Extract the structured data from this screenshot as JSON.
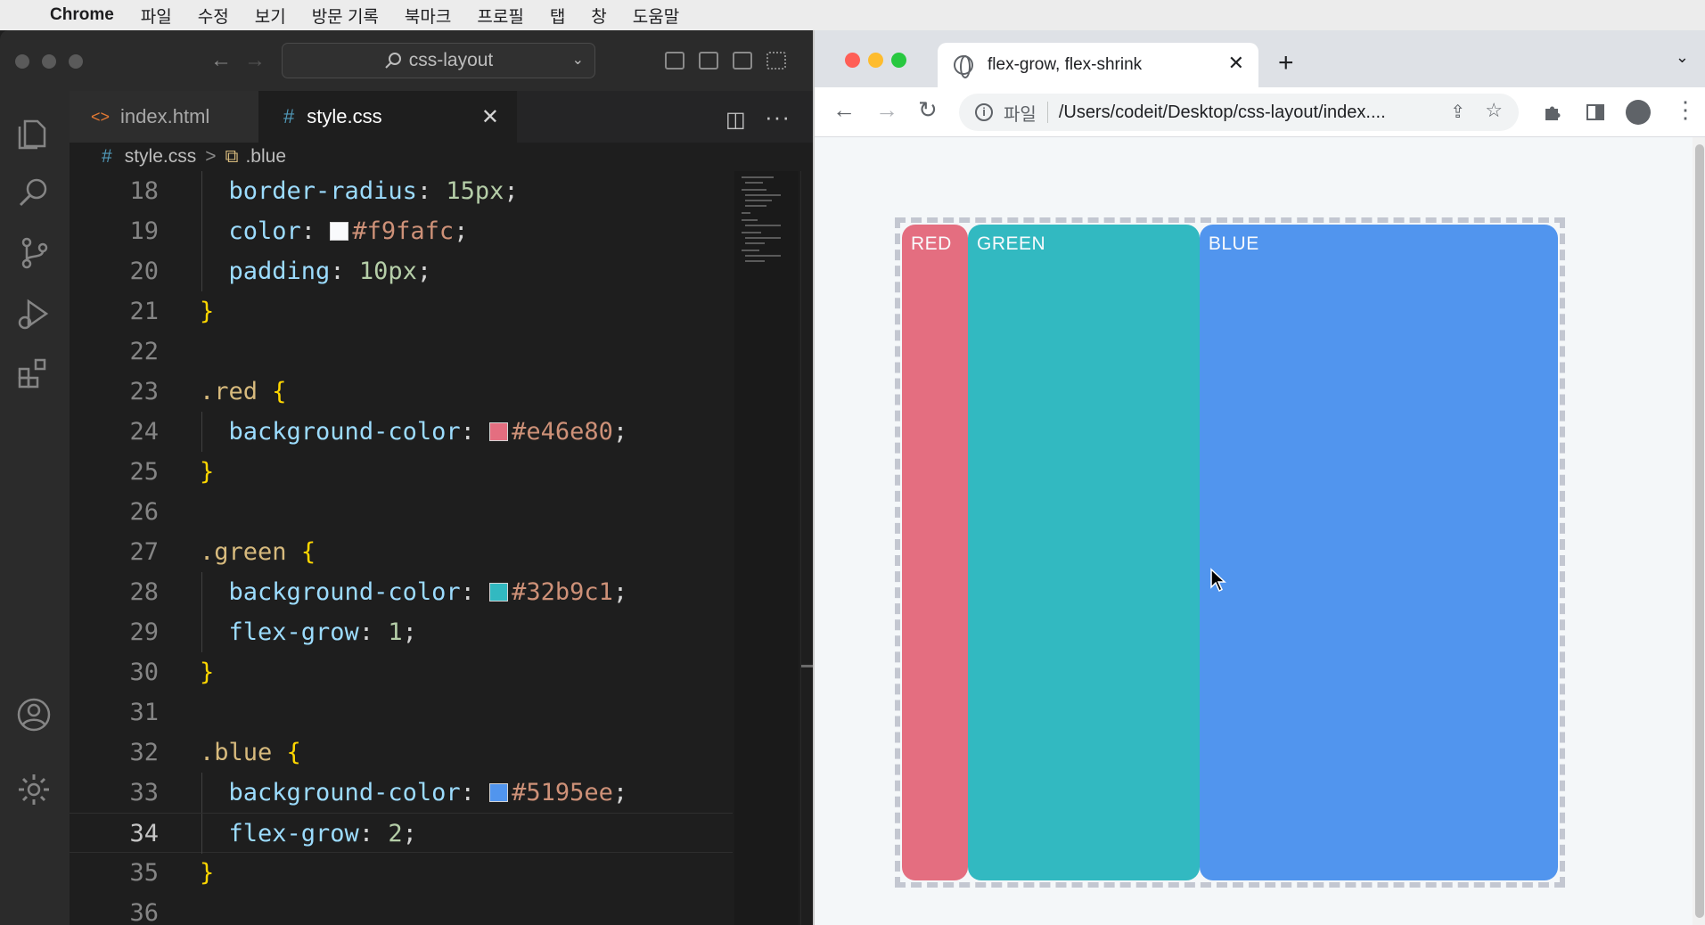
{
  "menubar": {
    "app_name": "Chrome",
    "items": [
      "파일",
      "수정",
      "보기",
      "방문 기록",
      "북마크",
      "프로필",
      "탭",
      "창",
      "도움말"
    ]
  },
  "vscode": {
    "search": {
      "text": "css-layout"
    },
    "tabs": [
      {
        "label": "index.html",
        "icon": "html-code-icon"
      },
      {
        "label": "style.css",
        "icon": "hash-icon",
        "active": true
      }
    ],
    "breadcrumb": {
      "file": "style.css",
      "separator": ">",
      "symbol": ".blue"
    },
    "code_lines": [
      {
        "n": "18",
        "tokens": [
          [
            "prop",
            "border-radius"
          ],
          [
            "punc",
            ": "
          ],
          [
            "num",
            "15px"
          ],
          [
            "punc",
            ";"
          ]
        ],
        "indent": true
      },
      {
        "n": "19",
        "tokens": [
          [
            "prop",
            "color"
          ],
          [
            "punc",
            ": "
          ],
          [
            "swatch",
            "#f9fafc"
          ],
          [
            "str",
            "#f9fafc"
          ],
          [
            "punc",
            ";"
          ]
        ],
        "indent": true
      },
      {
        "n": "20",
        "tokens": [
          [
            "prop",
            "padding"
          ],
          [
            "punc",
            ": "
          ],
          [
            "num",
            "10px"
          ],
          [
            "punc",
            ";"
          ]
        ],
        "indent": true
      },
      {
        "n": "21",
        "tokens": [
          [
            "brace",
            "}"
          ]
        ]
      },
      {
        "n": "22",
        "tokens": []
      },
      {
        "n": "23",
        "tokens": [
          [
            "sel",
            ".red"
          ],
          [
            "punc",
            " "
          ],
          [
            "brace",
            "{"
          ]
        ]
      },
      {
        "n": "24",
        "tokens": [
          [
            "prop",
            "background-color"
          ],
          [
            "punc",
            ": "
          ],
          [
            "swatch",
            "#e46e80"
          ],
          [
            "str",
            "#e46e80"
          ],
          [
            "punc",
            ";"
          ]
        ],
        "indent": true
      },
      {
        "n": "25",
        "tokens": [
          [
            "brace",
            "}"
          ]
        ]
      },
      {
        "n": "26",
        "tokens": []
      },
      {
        "n": "27",
        "tokens": [
          [
            "sel",
            ".green"
          ],
          [
            "punc",
            " "
          ],
          [
            "brace",
            "{"
          ]
        ]
      },
      {
        "n": "28",
        "tokens": [
          [
            "prop",
            "background-color"
          ],
          [
            "punc",
            ": "
          ],
          [
            "swatch",
            "#32b9c1"
          ],
          [
            "str",
            "#32b9c1"
          ],
          [
            "punc",
            ";"
          ]
        ],
        "indent": true
      },
      {
        "n": "29",
        "tokens": [
          [
            "prop",
            "flex-grow"
          ],
          [
            "punc",
            ": "
          ],
          [
            "num",
            "1"
          ],
          [
            "punc",
            ";"
          ]
        ],
        "indent": true
      },
      {
        "n": "30",
        "tokens": [
          [
            "brace",
            "}"
          ]
        ]
      },
      {
        "n": "31",
        "tokens": []
      },
      {
        "n": "32",
        "tokens": [
          [
            "sel",
            ".blue"
          ],
          [
            "punc",
            " "
          ],
          [
            "brace",
            "{"
          ]
        ]
      },
      {
        "n": "33",
        "tokens": [
          [
            "prop",
            "background-color"
          ],
          [
            "punc",
            ": "
          ],
          [
            "swatch",
            "#5195ee"
          ],
          [
            "str",
            "#5195ee"
          ],
          [
            "punc",
            ";"
          ]
        ],
        "indent": true
      },
      {
        "n": "34",
        "tokens": [
          [
            "prop",
            "flex-grow"
          ],
          [
            "punc",
            ": "
          ],
          [
            "num",
            "2"
          ],
          [
            "punc",
            ";"
          ]
        ],
        "indent": true,
        "active": true
      },
      {
        "n": "35",
        "tokens": [
          [
            "brace",
            "}"
          ]
        ]
      },
      {
        "n": "36",
        "tokens": []
      }
    ]
  },
  "chrome": {
    "tab_title": "flex-grow, flex-shrink",
    "address": {
      "scheme_label": "파일",
      "url": "/Users/codeit/Desktop/css-layout/index...."
    },
    "page": {
      "boxes": [
        {
          "label": "RED",
          "color": "#e46e80"
        },
        {
          "label": "GREEN",
          "color": "#32b9c1"
        },
        {
          "label": "BLUE",
          "color": "#5195ee"
        }
      ]
    }
  }
}
